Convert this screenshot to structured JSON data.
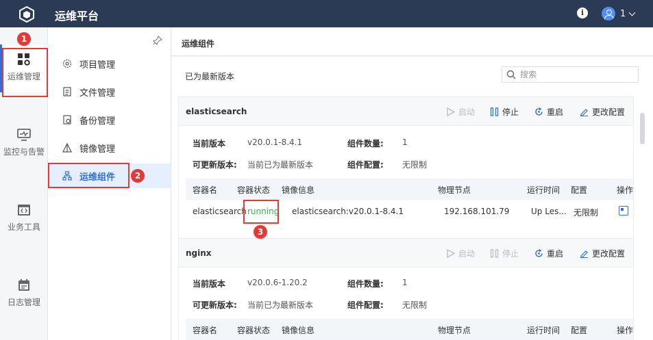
{
  "app": {
    "title": "运维平台",
    "user": "1"
  },
  "left_nav": [
    {
      "label": "运维管理",
      "icon": "apps-gear-icon",
      "active": true
    },
    {
      "label": "监控与告警",
      "icon": "monitor-icon",
      "active": false
    },
    {
      "label": "业务工具",
      "icon": "code-window-icon",
      "active": false
    },
    {
      "label": "日志管理",
      "icon": "calendar-log-icon",
      "active": false
    }
  ],
  "sub_nav": [
    {
      "label": "项目管理",
      "icon": "gear-icon"
    },
    {
      "label": "文件管理",
      "icon": "file-icon"
    },
    {
      "label": "备份管理",
      "icon": "backup-icon"
    },
    {
      "label": "镜像管理",
      "icon": "image-icon"
    },
    {
      "label": "运维组件",
      "icon": "component-tree-icon",
      "active": true
    }
  ],
  "annotations": [
    "1",
    "2",
    "3"
  ],
  "page": {
    "title": "运维组件",
    "status": "已为最新版本",
    "search_placeholder": "搜索"
  },
  "actions": {
    "start": "启动",
    "stop": "停止",
    "restart": "重启",
    "edit_config": "更改配置"
  },
  "labels": {
    "current_version": "当前版本",
    "updatable_version": "可更新版本:",
    "component_count": "组件数量:",
    "component_config": "组件配置:"
  },
  "table_columns": [
    "容器名",
    "容器状态",
    "镜像信息",
    "物理节点",
    "运行时间",
    "配置",
    "操作"
  ],
  "components": [
    {
      "name": "elasticsearch",
      "current_version": "v20.0.1-8.4.1",
      "updatable_version": "当前已为最新版本",
      "count": "1",
      "config": "无限制",
      "rows": [
        {
          "container": "elasticsearch",
          "status": "running",
          "image": "elasticsearch:v20.0.1-8.4.1",
          "node": "192.168.101.79",
          "uptime": "Up Les...",
          "config": "无限制"
        }
      ]
    },
    {
      "name": "nginx",
      "current_version": "v20.0.6-1.20.2",
      "updatable_version": "当前已为最新版本",
      "count": "1",
      "config": "无限制",
      "rows": []
    }
  ],
  "colors": {
    "topbar": "#2b3a55",
    "accent": "#2f6fdc",
    "running": "#2db84d",
    "highlight": "#e53935"
  }
}
